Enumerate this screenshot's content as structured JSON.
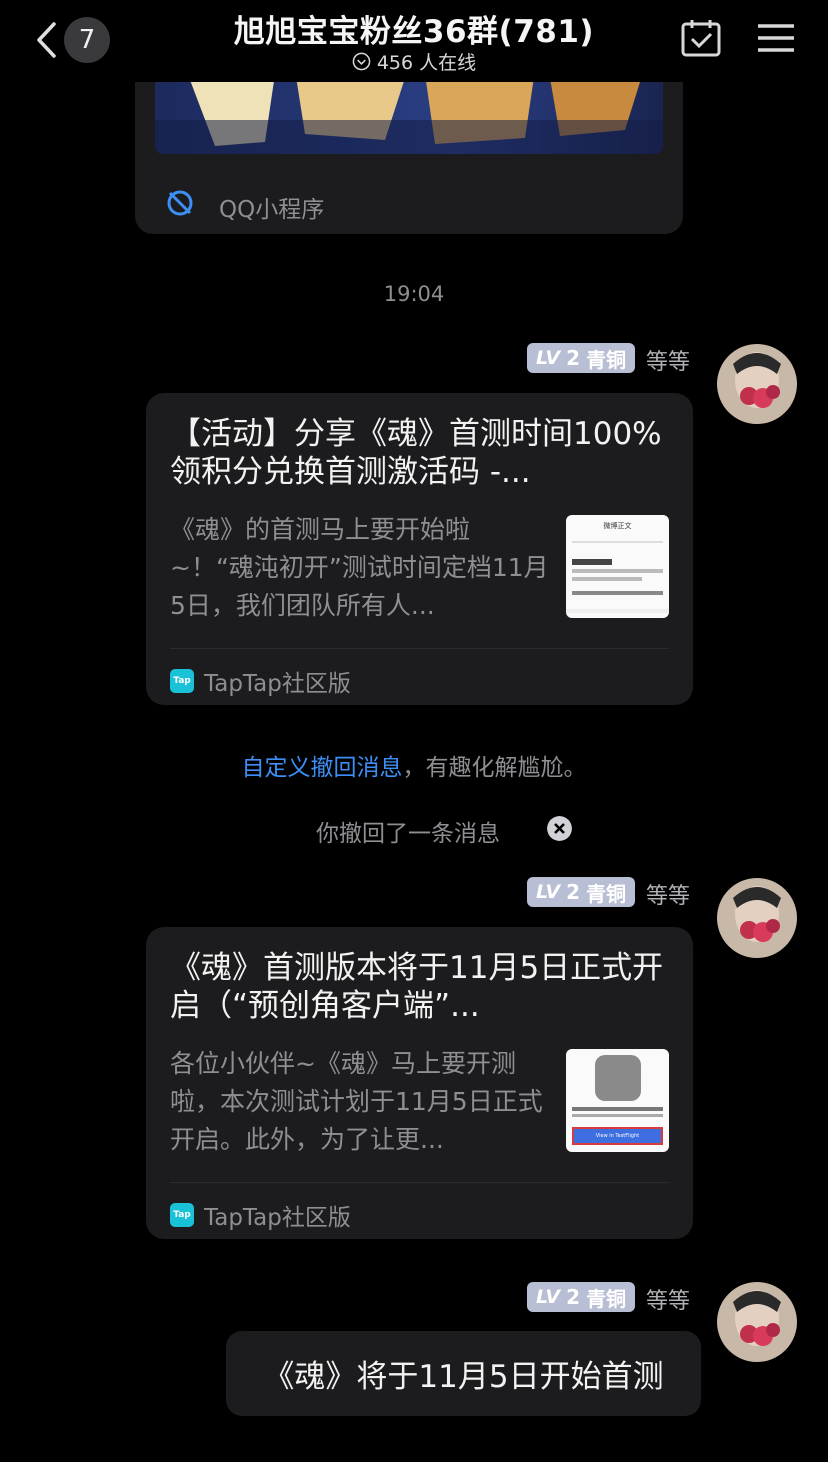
{
  "header": {
    "unread_count": "7",
    "title": "旭旭宝宝粉丝36群(781)",
    "online": "456 人在线"
  },
  "top_card": {
    "footer": "QQ小程序"
  },
  "timestamp": "19:04",
  "messages": [
    {
      "level": "2",
      "rank": "青铜",
      "sender": "等等",
      "title": "【活动】分享《魂》首测时间100%领积分兑换首测激活码 -...",
      "desc": "《魂》的首测马上要开始啦~！“魂沌初开”测试时间定档11月5日，我们团队所有人...",
      "source": "TapTap社区版",
      "thumb_heading": "微博正文"
    },
    {
      "level": "2",
      "rank": "青铜",
      "sender": "等等",
      "title": "《魂》首测版本将于11月5日正式开启（“预创角客户端”...",
      "desc": "各位小伙伴~《魂》马上要开测啦，本次测试计划于11月5日正式开启。此外，为了让更...",
      "source": "TapTap社区版",
      "thumb_button": "View in TestFlight"
    },
    {
      "level": "2",
      "rank": "青铜",
      "sender": "等等",
      "text": "《魂》将于11月5日开始首测"
    }
  ],
  "system": {
    "recall_link": "自定义撤回消息",
    "recall_rest": "，有趣化解尴尬。",
    "recalled": "你撤回了一条消息"
  }
}
